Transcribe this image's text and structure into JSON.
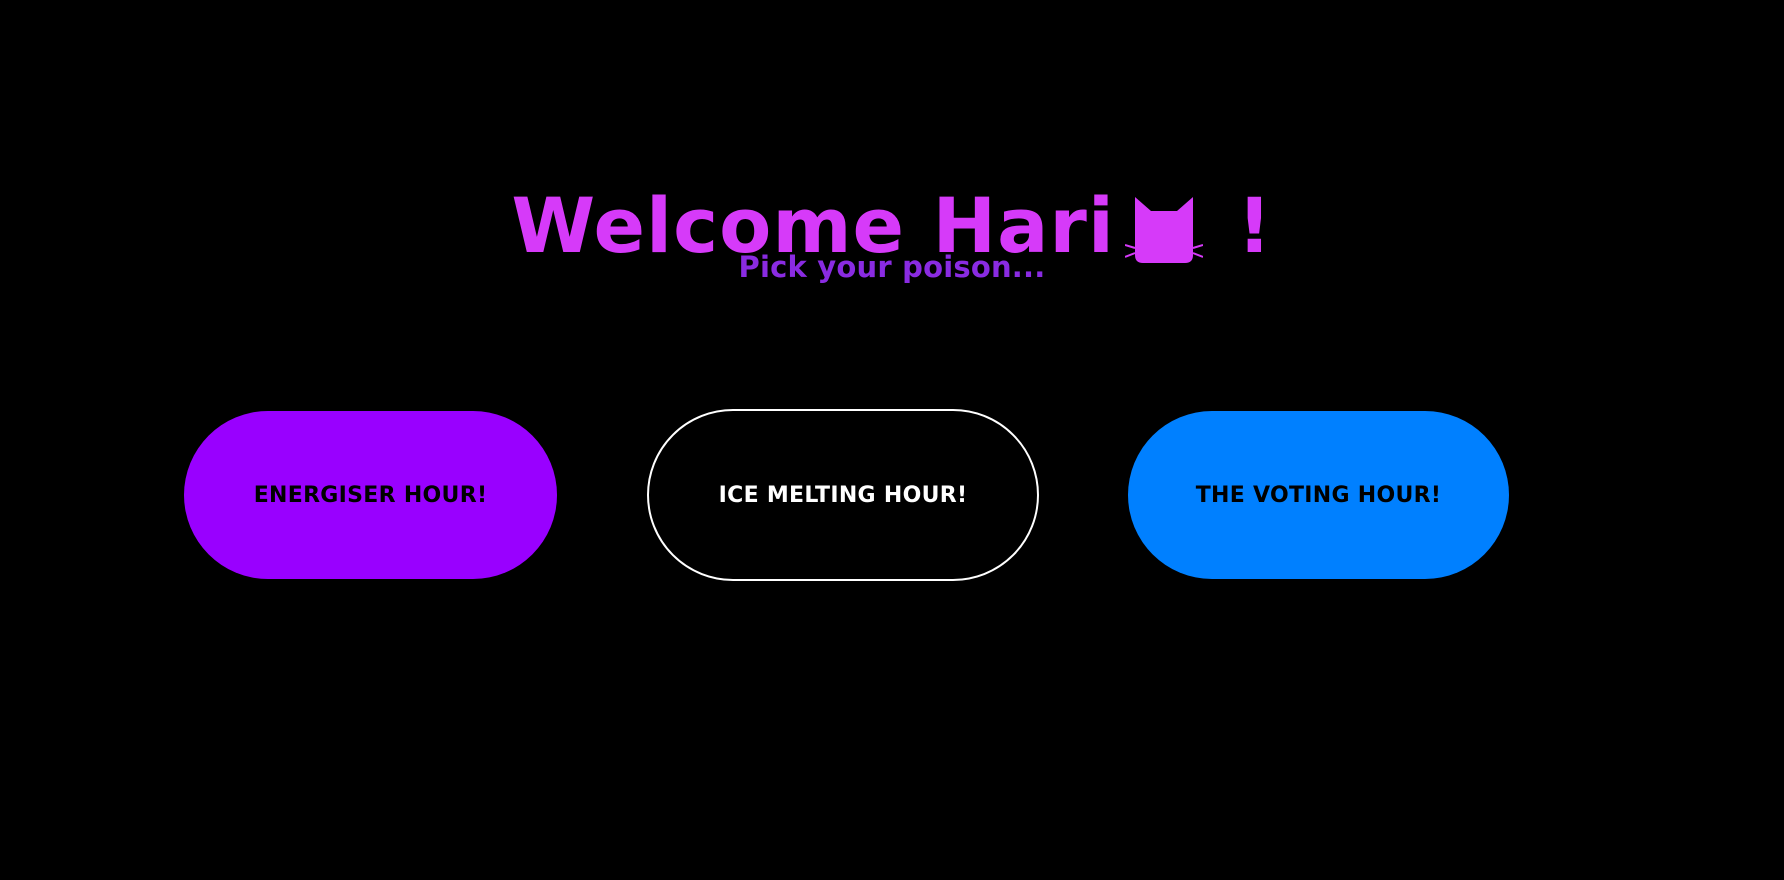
{
  "header": {
    "title_prefix": "Welcome Hari",
    "title_icon": "cat-face-icon",
    "title_suffix": "!",
    "subtitle": "Pick your poison..."
  },
  "buttons": [
    {
      "label": "ENERGISER HOUR!",
      "style": "filled",
      "color": "#9900FF"
    },
    {
      "label": "ICE MELTING HOUR!",
      "style": "outline",
      "color": "#FFFFFF"
    },
    {
      "label": "THE VOTING HOUR!",
      "style": "filled",
      "color": "#0080FF"
    }
  ],
  "colors": {
    "background": "#000000",
    "title": "#D63AF9",
    "subtitle": "#8A2BE2"
  }
}
